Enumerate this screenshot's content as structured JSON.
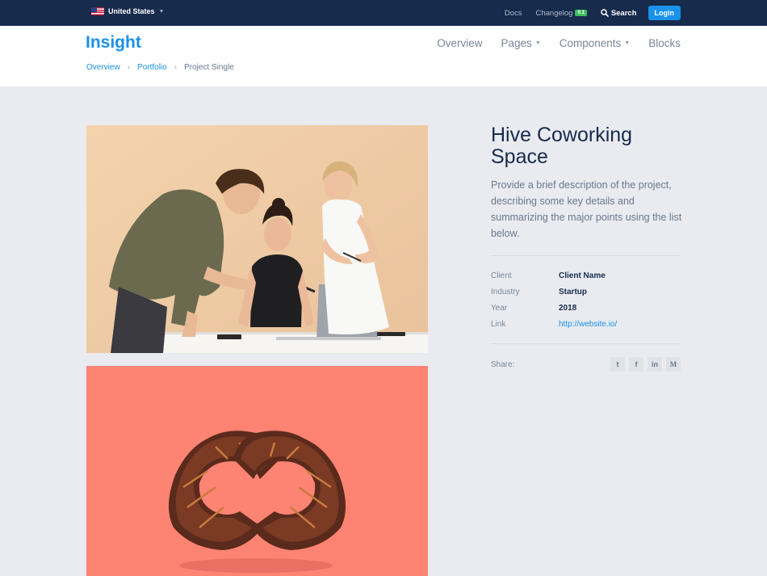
{
  "topbar": {
    "country": "United States",
    "docs": "Docs",
    "changelog": "Changelog",
    "changelog_badge": "0.1",
    "search": "Search",
    "login": "Login"
  },
  "header": {
    "brand": "Insight",
    "nav": [
      {
        "label": "Overview"
      },
      {
        "label": "Pages"
      },
      {
        "label": "Components"
      },
      {
        "label": "Blocks"
      }
    ]
  },
  "breadcrumb": {
    "items": [
      "Overview",
      "Portfolio"
    ],
    "current": "Project Single"
  },
  "project": {
    "title": "Hive Coworking Space",
    "description": "Provide a brief description of the project, describing some key details and summarizing the major points using the list below.",
    "details": [
      {
        "label": "Client",
        "value": "Client Name"
      },
      {
        "label": "Industry",
        "value": "Startup"
      },
      {
        "label": "Year",
        "value": "2018"
      },
      {
        "label": "Link",
        "value": "http://website.io/"
      }
    ],
    "share_label": "Share:",
    "social": [
      {
        "icon": "twitter-icon",
        "glyph": "t"
      },
      {
        "icon": "facebook-icon",
        "glyph": "f"
      },
      {
        "icon": "linkedin-icon",
        "glyph": "in"
      },
      {
        "icon": "medium-icon",
        "glyph": "M"
      }
    ]
  }
}
